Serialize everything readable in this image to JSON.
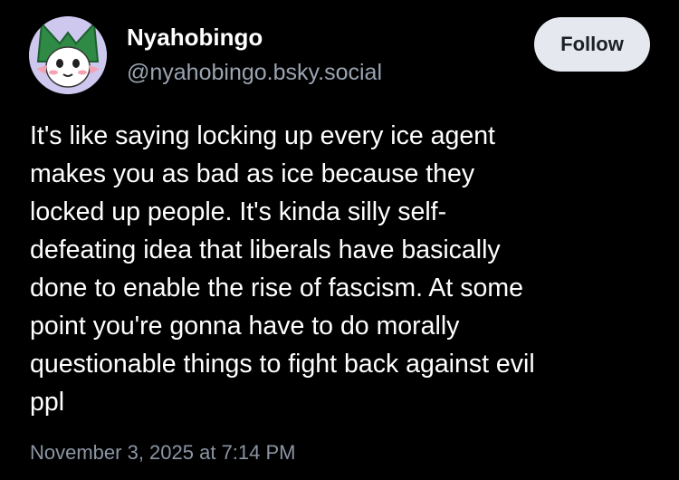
{
  "author": {
    "display_name": "Nyahobingo",
    "handle": "@nyahobingo.bsky.social",
    "avatar_icon": "cat-character-avatar"
  },
  "actions": {
    "follow_label": "Follow"
  },
  "post": {
    "lines": [
      "It's like saying locking up every ice agent",
      "makes you as bad as ice because they",
      "locked up people. It's kinda silly self-",
      "defeating idea that liberals have basically",
      "done to enable the rise of fascism. At some",
      "point you're gonna have to do morally",
      "questionable things to fight back against evil",
      "ppl"
    ],
    "timestamp": "November 3, 2025 at 7:14 PM"
  },
  "colors": {
    "background": "#000000",
    "text": "#ffffff",
    "handle": "#9aa4b2",
    "follow_bg": "#e5e8ee"
  }
}
